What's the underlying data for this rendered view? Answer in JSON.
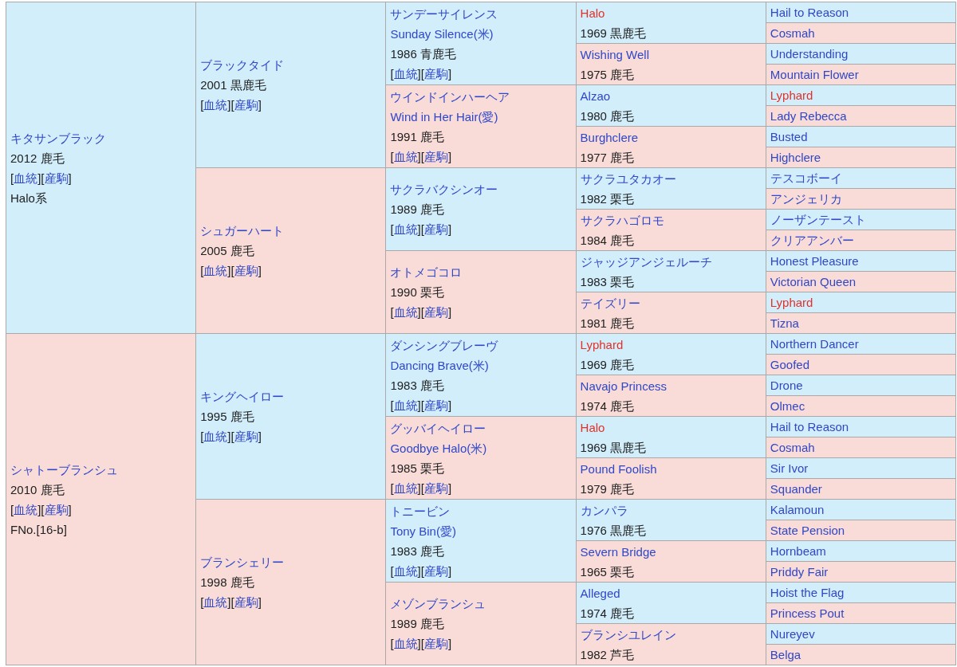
{
  "pedigree": {
    "name": "キタサンブラック",
    "info": "2012 鹿毛",
    "links": [
      "[血統]",
      "[産駒]"
    ],
    "note": "Halo系",
    "inbred": false,
    "parents": [
      {
        "name": "ブラックタイド",
        "info": "2001 黒鹿毛",
        "links": [
          "[血統]",
          "[産駒]"
        ],
        "inbred": false,
        "parents": [
          {
            "name": "サンデーサイレンス",
            "foreign_name": "Sunday Silence(米)",
            "info": "1986 青鹿毛",
            "links": [
              "[血統]",
              "[産駒]"
            ],
            "inbred": false,
            "parents": [
              {
                "name": "Halo",
                "info": "1969 黒鹿毛",
                "inbred": true,
                "parents": [
                  {
                    "name": "Hail to Reason",
                    "inbred": false
                  },
                  {
                    "name": "Cosmah",
                    "inbred": false
                  }
                ]
              },
              {
                "name": "Wishing Well",
                "info": "1975 鹿毛",
                "inbred": false,
                "parents": [
                  {
                    "name": "Understanding",
                    "inbred": false
                  },
                  {
                    "name": "Mountain Flower",
                    "inbred": false
                  }
                ]
              }
            ]
          },
          {
            "name": "ウインドインハーヘア",
            "foreign_name": "Wind in Her Hair(愛)",
            "info": "1991 鹿毛",
            "links": [
              "[血統]",
              "[産駒]"
            ],
            "inbred": false,
            "parents": [
              {
                "name": "Alzao",
                "info": "1980 鹿毛",
                "inbred": false,
                "parents": [
                  {
                    "name": "Lyphard",
                    "inbred": true
                  },
                  {
                    "name": "Lady Rebecca",
                    "inbred": false
                  }
                ]
              },
              {
                "name": "Burghclere",
                "info": "1977 鹿毛",
                "inbred": false,
                "parents": [
                  {
                    "name": "Busted",
                    "inbred": false
                  },
                  {
                    "name": "Highclere",
                    "inbred": false
                  }
                ]
              }
            ]
          }
        ]
      },
      {
        "name": "シュガーハート",
        "info": "2005 鹿毛",
        "links": [
          "[血統]",
          "[産駒]"
        ],
        "inbred": false,
        "parents": [
          {
            "name": "サクラバクシンオー",
            "info": "1989 鹿毛",
            "links": [
              "[血統]",
              "[産駒]"
            ],
            "inbred": false,
            "parents": [
              {
                "name": "サクラユタカオー",
                "info": "1982 栗毛",
                "inbred": false,
                "parents": [
                  {
                    "name": "テスコボーイ",
                    "inbred": false
                  },
                  {
                    "name": "アンジェリカ",
                    "inbred": false
                  }
                ]
              },
              {
                "name": "サクラハゴロモ",
                "info": "1984 鹿毛",
                "inbred": false,
                "parents": [
                  {
                    "name": "ノーザンテースト",
                    "inbred": false
                  },
                  {
                    "name": "クリアアンバー",
                    "inbred": false
                  }
                ]
              }
            ]
          },
          {
            "name": "オトメゴコロ",
            "info": "1990 栗毛",
            "links": [
              "[血統]",
              "[産駒]"
            ],
            "inbred": false,
            "parents": [
              {
                "name": "ジャッジアンジェルーチ",
                "info": "1983 栗毛",
                "inbred": false,
                "parents": [
                  {
                    "name": "Honest Pleasure",
                    "inbred": false
                  },
                  {
                    "name": "Victorian Queen",
                    "inbred": false
                  }
                ]
              },
              {
                "name": "テイズリー",
                "info": "1981 鹿毛",
                "inbred": false,
                "parents": [
                  {
                    "name": "Lyphard",
                    "inbred": true
                  },
                  {
                    "name": "Tizna",
                    "inbred": false
                  }
                ]
              }
            ]
          }
        ]
      }
    ]
  },
  "dam": {
    "name": "シャトーブランシュ",
    "info": "2010 鹿毛",
    "links": [
      "[血統]",
      "[産駒]"
    ],
    "note": "FNo.[16-b]",
    "inbred": false,
    "parents": [
      {
        "name": "キングヘイロー",
        "info": "1995 鹿毛",
        "links": [
          "[血統]",
          "[産駒]"
        ],
        "inbred": false,
        "parents": [
          {
            "name": "ダンシングブレーヴ",
            "foreign_name": "Dancing Brave(米)",
            "info": "1983 鹿毛",
            "links": [
              "[血統]",
              "[産駒]"
            ],
            "inbred": false,
            "parents": [
              {
                "name": "Lyphard",
                "info": "1969 鹿毛",
                "inbred": true,
                "parents": [
                  {
                    "name": "Northern Dancer",
                    "inbred": false
                  },
                  {
                    "name": "Goofed",
                    "inbred": false
                  }
                ]
              },
              {
                "name": "Navajo Princess",
                "info": "1974 鹿毛",
                "inbred": false,
                "parents": [
                  {
                    "name": "Drone",
                    "inbred": false
                  },
                  {
                    "name": "Olmec",
                    "inbred": false
                  }
                ]
              }
            ]
          },
          {
            "name": "グッバイヘイロー",
            "foreign_name": "Goodbye Halo(米)",
            "info": "1985 栗毛",
            "links": [
              "[血統]",
              "[産駒]"
            ],
            "inbred": false,
            "parents": [
              {
                "name": "Halo",
                "info": "1969 黒鹿毛",
                "inbred": true,
                "parents": [
                  {
                    "name": "Hail to Reason",
                    "inbred": false
                  },
                  {
                    "name": "Cosmah",
                    "inbred": false
                  }
                ]
              },
              {
                "name": "Pound Foolish",
                "info": "1979 鹿毛",
                "inbred": false,
                "parents": [
                  {
                    "name": "Sir Ivor",
                    "inbred": false
                  },
                  {
                    "name": "Squander",
                    "inbred": false
                  }
                ]
              }
            ]
          }
        ]
      },
      {
        "name": "ブランシェリー",
        "info": "1998 鹿毛",
        "links": [
          "[血統]",
          "[産駒]"
        ],
        "inbred": false,
        "parents": [
          {
            "name": "トニービン",
            "foreign_name": "Tony Bin(愛)",
            "info": "1983 鹿毛",
            "links": [
              "[血統]",
              "[産駒]"
            ],
            "inbred": false,
            "parents": [
              {
                "name": "カンパラ",
                "info": "1976 黒鹿毛",
                "inbred": false,
                "parents": [
                  {
                    "name": "Kalamoun",
                    "inbred": false
                  },
                  {
                    "name": "State Pension",
                    "inbred": false
                  }
                ]
              },
              {
                "name": "Severn Bridge",
                "info": "1965 栗毛",
                "inbred": false,
                "parents": [
                  {
                    "name": "Hornbeam",
                    "inbred": false
                  },
                  {
                    "name": "Priddy Fair",
                    "inbred": false
                  }
                ]
              }
            ]
          },
          {
            "name": "メゾンブランシュ",
            "info": "1989 鹿毛",
            "links": [
              "[血統]",
              "[産駒]"
            ],
            "inbred": false,
            "parents": [
              {
                "name": "Alleged",
                "info": "1974 鹿毛",
                "inbred": false,
                "parents": [
                  {
                    "name": "Hoist the Flag",
                    "inbred": false
                  },
                  {
                    "name": "Princess Pout",
                    "inbred": false
                  }
                ]
              },
              {
                "name": "ブランシユレイン",
                "info": "1982 芦毛",
                "inbred": false,
                "parents": [
                  {
                    "name": "Nureyev",
                    "inbred": false
                  },
                  {
                    "name": "Belga",
                    "inbred": false
                  }
                ]
              }
            ]
          }
        ]
      }
    ]
  }
}
